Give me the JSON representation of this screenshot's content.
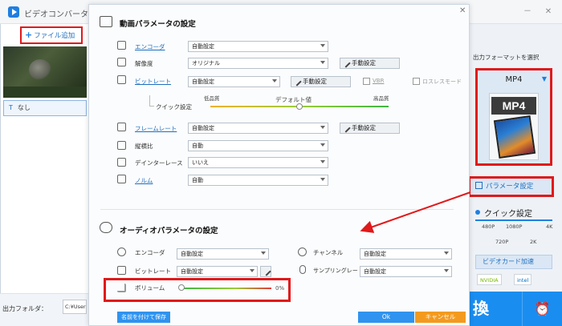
{
  "app": {
    "title": "ビデオコンバータ",
    "add_file": "ファイル追加",
    "subtitle": "なし",
    "output_folder_label": "出力フォルダ：",
    "output_folder_path": "C:¥Users¥",
    "minimize": "－",
    "close": "✕"
  },
  "right_panel": {
    "select_format_label": "出力フォーマットを選択",
    "format": "MP4",
    "format_icon_text": "MP4",
    "param_button": "パラメータ設定",
    "quick_settings": "クイック設定",
    "quick_ticks": [
      "480P",
      "1080P",
      "4K",
      "720P",
      "2K"
    ],
    "gpu_accel": "ビデオカード加速",
    "gpu_vendors": [
      "NVIDIA",
      "intel"
    ],
    "convert": "換",
    "alarm_icon": "alarm-clock-icon"
  },
  "dialog": {
    "video_section_title": "動画パラメータの設定",
    "video": {
      "encoder": {
        "label": "エンコーダ",
        "value": "自動設定"
      },
      "resolution": {
        "label": "解像度",
        "value": "オリジナル",
        "manual": "手動設定"
      },
      "bitrate": {
        "label": "ビットレート",
        "value": "自動設定",
        "manual": "手動設定",
        "vbr": "VBR",
        "lossless": "ロスレスモード"
      },
      "quick_setting": {
        "label": "クイック設定",
        "low": "低品質",
        "default": "デフォルト値",
        "high": "高品質",
        "value_fraction": 0.5
      },
      "framerate": {
        "label": "フレームレート",
        "value": "自動設定",
        "manual": "手動設定"
      },
      "aspect": {
        "label": "縦横比",
        "value": "自動"
      },
      "deinterlace": {
        "label": "デインターレース",
        "value": "いいえ"
      },
      "norm": {
        "label": "ノルム",
        "value": "自動"
      }
    },
    "audio_section_title": "オーディオパラメータの設定",
    "audio": {
      "encoder": {
        "label": "エンコーダ",
        "value": "自動設定"
      },
      "channel": {
        "label": "チャンネル",
        "value": "自動設定"
      },
      "bitrate": {
        "label": "ビットレート",
        "value": "自動設定"
      },
      "sample_rate": {
        "label": "サンプリングレート",
        "value": "自動設定"
      },
      "volume": {
        "label": "ボリューム",
        "value": "0%",
        "value_fraction": 0.0
      }
    },
    "save_as": "名前を付けて保存",
    "ok": "Ok",
    "cancel": "キャンセル",
    "close": "✕"
  },
  "colors": {
    "accent": "#2f93ef",
    "cancel": "#f39a1e",
    "highlight": "#e0191b"
  }
}
